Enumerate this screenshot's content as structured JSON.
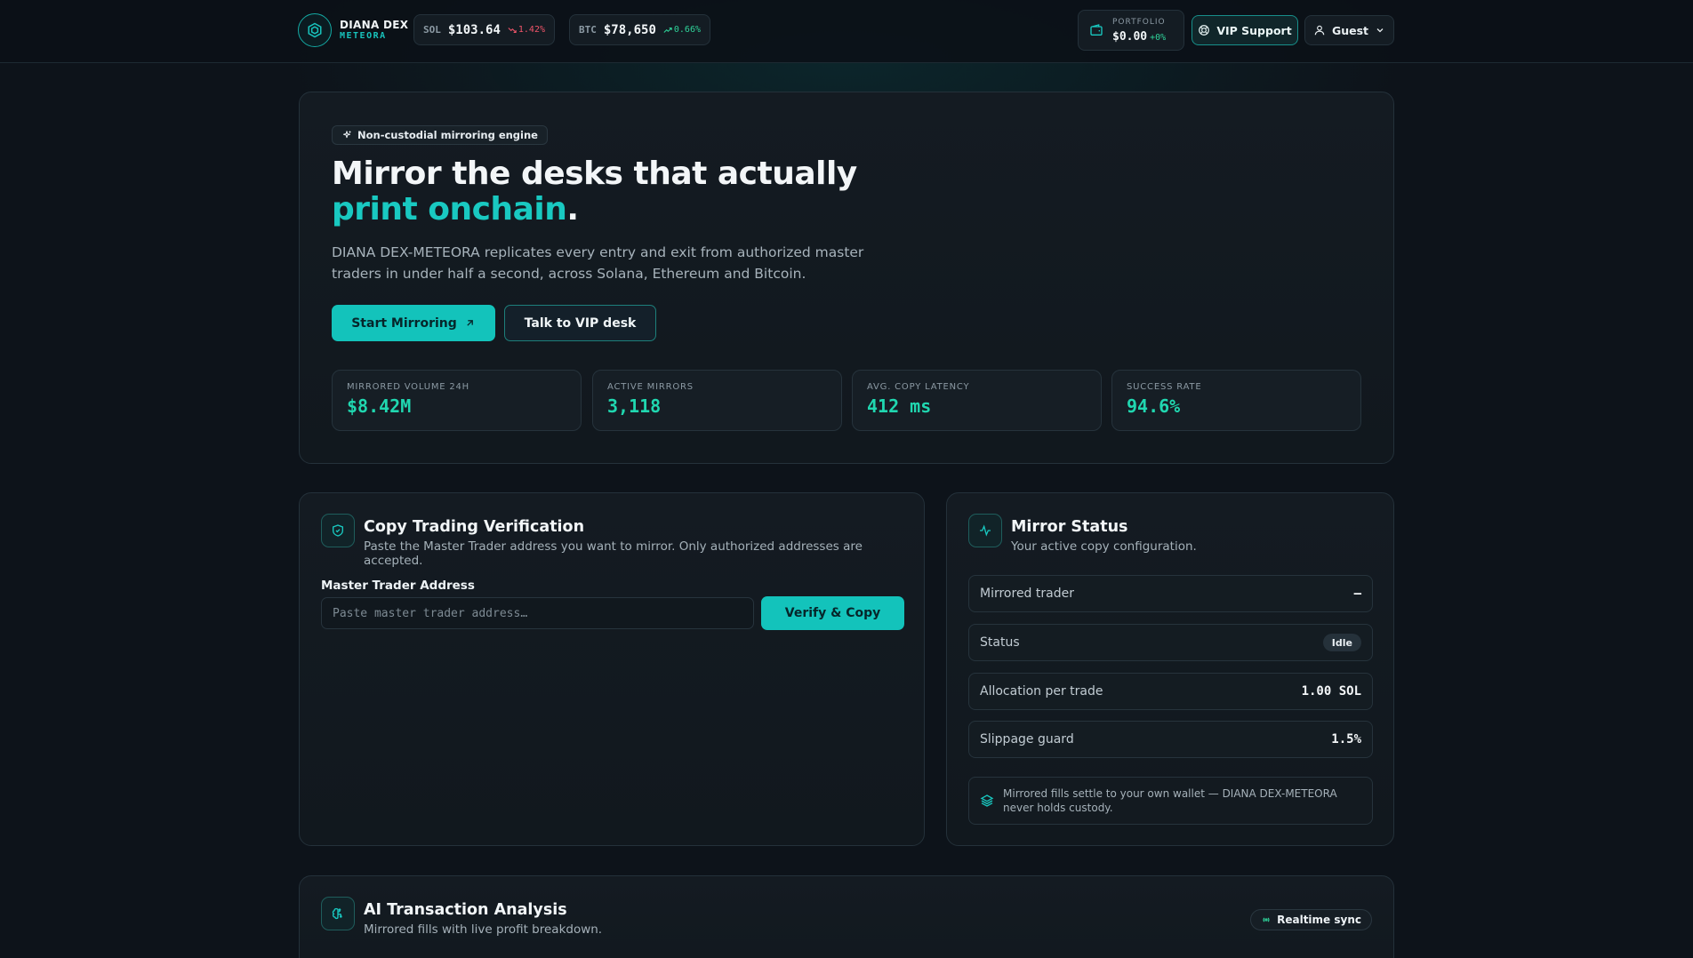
{
  "brand": {
    "name": "DIANA DEX",
    "sub": "METEORA"
  },
  "tickers": [
    {
      "symbol": "SOL",
      "price": "$103.64",
      "change": "1.42%",
      "direction": "down"
    },
    {
      "symbol": "BTC",
      "price": "$78,650",
      "change": "0.66%",
      "direction": "up"
    }
  ],
  "portfolio": {
    "label": "PORTFOLIO",
    "value": "$0.00",
    "change": "+0%"
  },
  "header": {
    "vip_label": "VIP Support",
    "user_label": "Guest"
  },
  "hero": {
    "pill": "Non-custodial mirroring engine",
    "title_main": "Mirror the desks that actually ",
    "title_accent": "print onchain",
    "title_end": ".",
    "description": "DIANA DEX-METEORA replicates every entry and exit from authorized master traders in under half a second, across Solana, Ethereum and Bitcoin.",
    "primary_cta": "Start Mirroring",
    "secondary_cta": "Talk to VIP desk",
    "stats": [
      {
        "label": "MIRRORED VOLUME 24H",
        "value": "$8.42M"
      },
      {
        "label": "ACTIVE MIRRORS",
        "value": "3,118"
      },
      {
        "label": "AVG. COPY LATENCY",
        "value": "412 ms"
      },
      {
        "label": "SUCCESS RATE",
        "value": "94.6%"
      }
    ]
  },
  "verification": {
    "title": "Copy Trading Verification",
    "subtitle": "Paste the Master Trader address you want to mirror. Only authorized addresses are accepted.",
    "field_label": "Master Trader Address",
    "placeholder": "Paste master trader address…",
    "value": "",
    "button": "Verify & Copy"
  },
  "mirror_status": {
    "title": "Mirror Status",
    "subtitle": "Your active copy configuration.",
    "rows": [
      {
        "key": "Mirrored trader",
        "value": "–"
      },
      {
        "key": "Status",
        "value": "Idle"
      },
      {
        "key": "Allocation per trade",
        "value": "1.00 SOL"
      },
      {
        "key": "Slippage guard",
        "value": "1.5%"
      }
    ],
    "note": "Mirrored fills settle to your own wallet — DIANA DEX-METEORA never holds custody."
  },
  "analysis": {
    "title": "AI Transaction Analysis",
    "subtitle": "Mirrored fills with live profit breakdown.",
    "sync_label": "Realtime sync"
  },
  "colors": {
    "accent": "#13c3bb",
    "up": "#2fd39a",
    "down": "#f0556a",
    "background": "#0d131a"
  }
}
